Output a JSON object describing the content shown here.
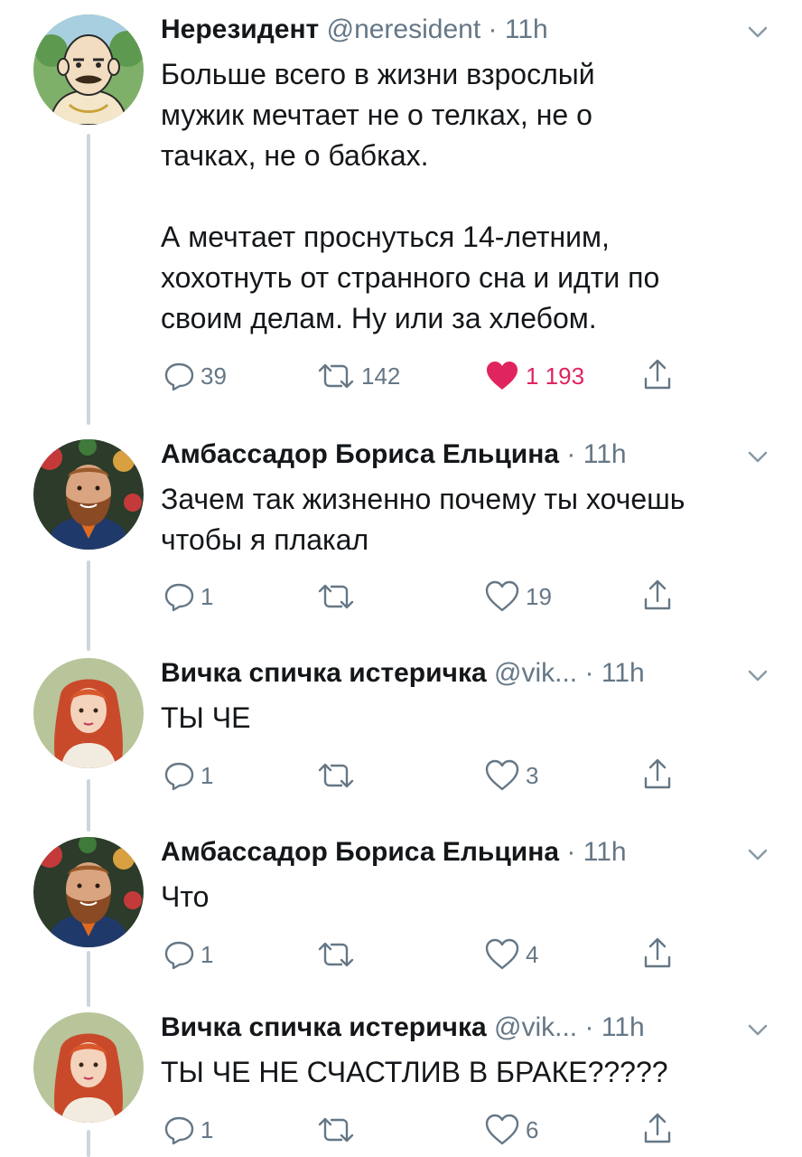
{
  "tweets": [
    {
      "author": "Нерезидент",
      "handle": "@neresident",
      "separator": "·",
      "time": "11h",
      "text": "Больше всего в жизни взрослый\nмужик мечтает не о телках, не о\nтачках, не о бабках.\n\nА мечтает проснуться 14-летним,\nхохотнуть от странного сна и идти по\nсвоим делам. Ну или за хлебом.",
      "replies": "39",
      "retweets": "142",
      "likes": "1 193",
      "liked": true
    },
    {
      "author": "Амбассадор Бориса Ельцина",
      "handle": "",
      "separator": "·",
      "time": "11h",
      "text": "Зачем так жизненно почему ты хочешь\nчтобы я плакал",
      "replies": "1",
      "retweets": "",
      "likes": "19",
      "liked": false
    },
    {
      "author": "Вичка спичка истеричка",
      "handle": "@vik...",
      "separator": "·",
      "time": "11h",
      "text": "ТЫ ЧЕ",
      "replies": "1",
      "retweets": "",
      "likes": "3",
      "liked": false
    },
    {
      "author": "Амбассадор Бориса Ельцина",
      "handle": "",
      "separator": "·",
      "time": "11h",
      "text": "Что",
      "replies": "1",
      "retweets": "",
      "likes": "4",
      "liked": false
    },
    {
      "author": "Вичка спичка истеричка",
      "handle": "@vik...",
      "separator": "·",
      "time": "11h",
      "text": "ТЫ ЧЕ НЕ СЧАСТЛИВ В БРАКЕ?????",
      "replies": "1",
      "retweets": "",
      "likes": "6",
      "liked": false
    }
  ],
  "icons": {
    "reply": "reply-icon",
    "retweet": "retweet-icon",
    "like": "heart-icon",
    "share": "share-icon",
    "menu": "chevron-down-icon"
  },
  "colors": {
    "text": "#14171a",
    "secondary": "#657786",
    "like": "#e0245e",
    "thread_line": "#ccd6dd"
  }
}
